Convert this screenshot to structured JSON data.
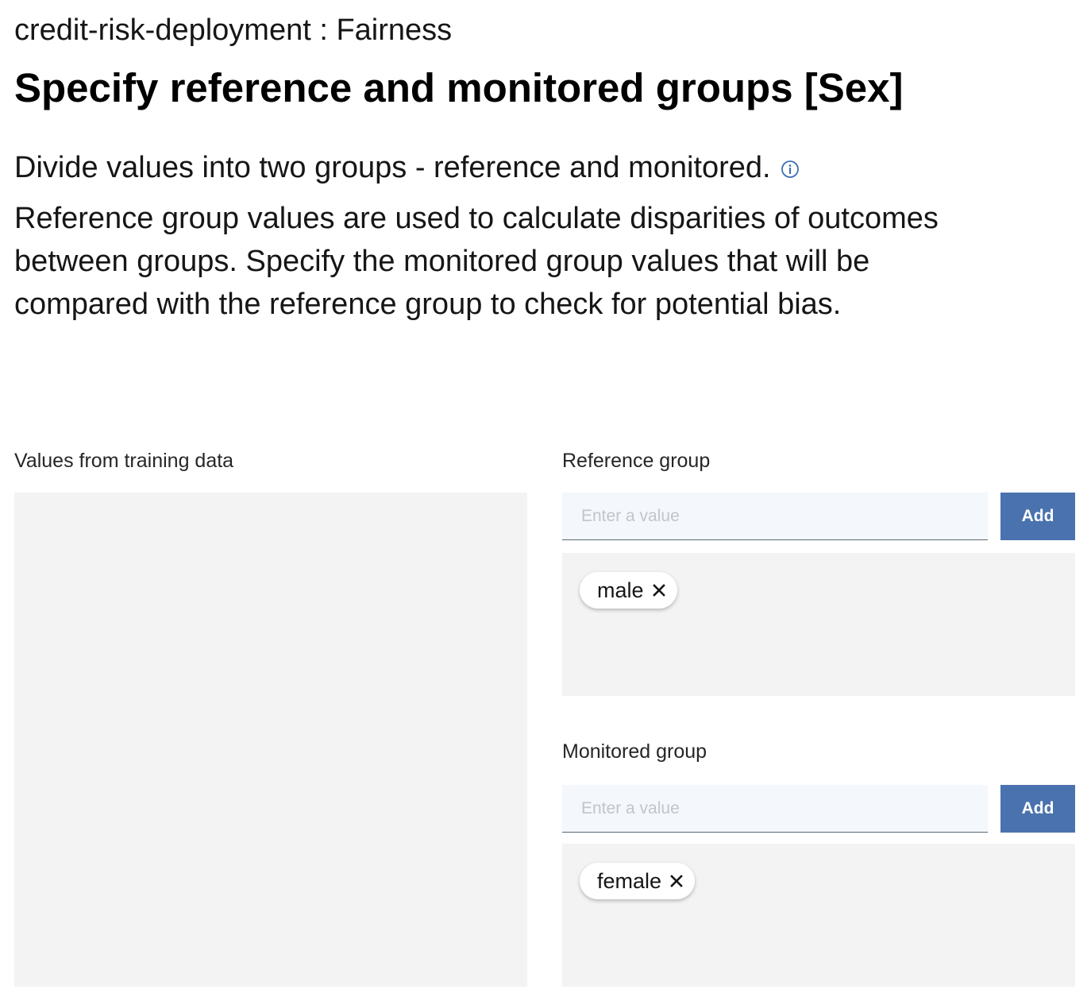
{
  "header": {
    "breadcrumb": "credit-risk-deployment : Fairness",
    "title": "Specify reference and monitored groups [Sex]"
  },
  "intro": {
    "text": "Divide values into two groups - reference and monitored.",
    "info_icon": "info-icon"
  },
  "description": "Reference group values are used to calculate disparities of outcomes between groups. Specify the monitored group values that will be compared with the reference group to check for potential bias.",
  "training": {
    "label": "Values from training data",
    "values": []
  },
  "reference_group": {
    "label": "Reference group",
    "input_placeholder": "Enter a value",
    "input_value": "",
    "add_label": "Add",
    "tags": [
      "male"
    ]
  },
  "monitored_group": {
    "label": "Monitored group",
    "input_placeholder": "Enter a value",
    "input_value": "",
    "add_label": "Add",
    "tags": [
      "female"
    ]
  },
  "colors": {
    "button_bg": "#4a72ae",
    "panel_bg": "#f3f3f3",
    "input_bg": "#f4f7fb"
  }
}
